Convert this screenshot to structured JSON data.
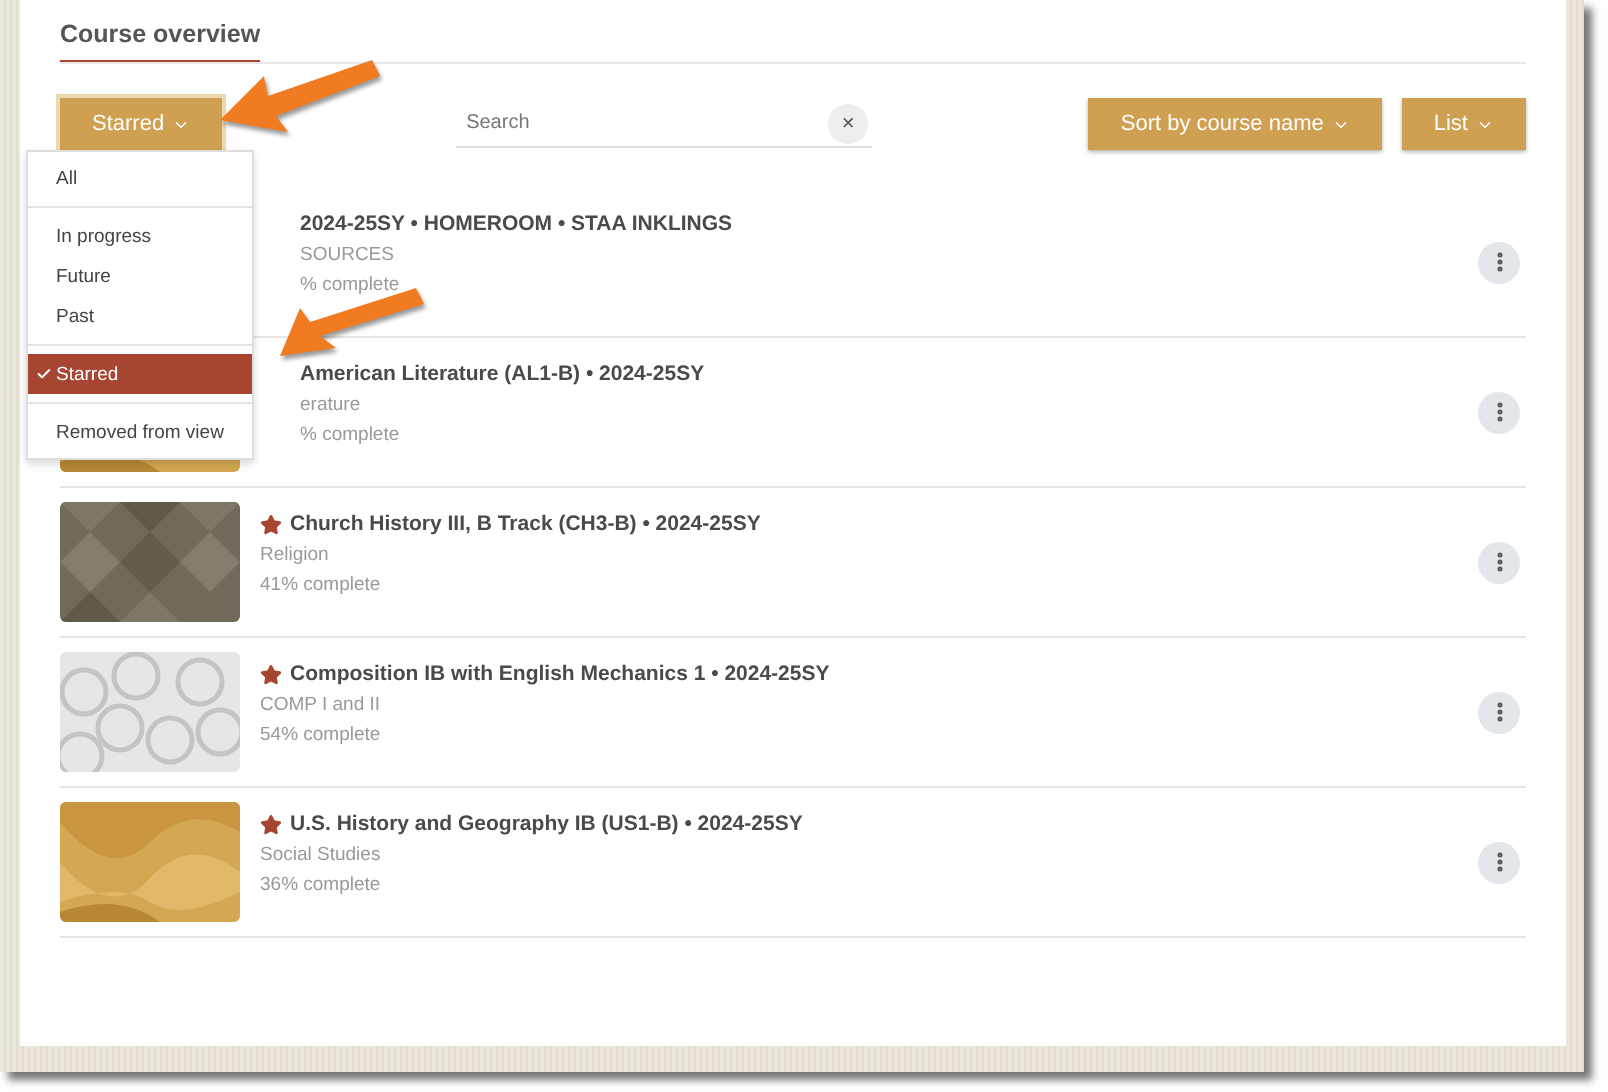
{
  "header": {
    "title": "Course overview"
  },
  "filter": {
    "label": "Starred",
    "open": true,
    "groups": [
      [
        {
          "label": "All",
          "selected": false
        }
      ],
      [
        {
          "label": "In progress",
          "selected": false
        },
        {
          "label": "Future",
          "selected": false
        },
        {
          "label": "Past",
          "selected": false
        }
      ],
      [
        {
          "label": "Starred",
          "selected": true
        }
      ],
      [
        {
          "label": "Removed from view",
          "selected": false
        }
      ]
    ]
  },
  "search": {
    "placeholder": "Search",
    "clear": "×"
  },
  "sort": {
    "label": "Sort by course name"
  },
  "view": {
    "label": "List"
  },
  "courses": [
    {
      "title": "2024-25SY • HOMEROOM • STAA INKLINGS",
      "category": "SOURCES",
      "progress": "% complete"
    },
    {
      "title": "American Literature (AL1-B) • 2024-25SY",
      "category": "erature",
      "progress": "% complete"
    },
    {
      "title": "Church History III, B Track (CH3-B) • 2024-25SY",
      "category": "Religion",
      "progress": "41% complete",
      "starred": true
    },
    {
      "title": "Composition IB with English Mechanics 1 • 2024-25SY",
      "category": "COMP I and II",
      "progress": "54% complete",
      "starred": true
    },
    {
      "title": "U.S. History and Geography IB (US1-B) • 2024-25SY",
      "category": "Social Studies",
      "progress": "36% complete",
      "starred": true
    }
  ]
}
